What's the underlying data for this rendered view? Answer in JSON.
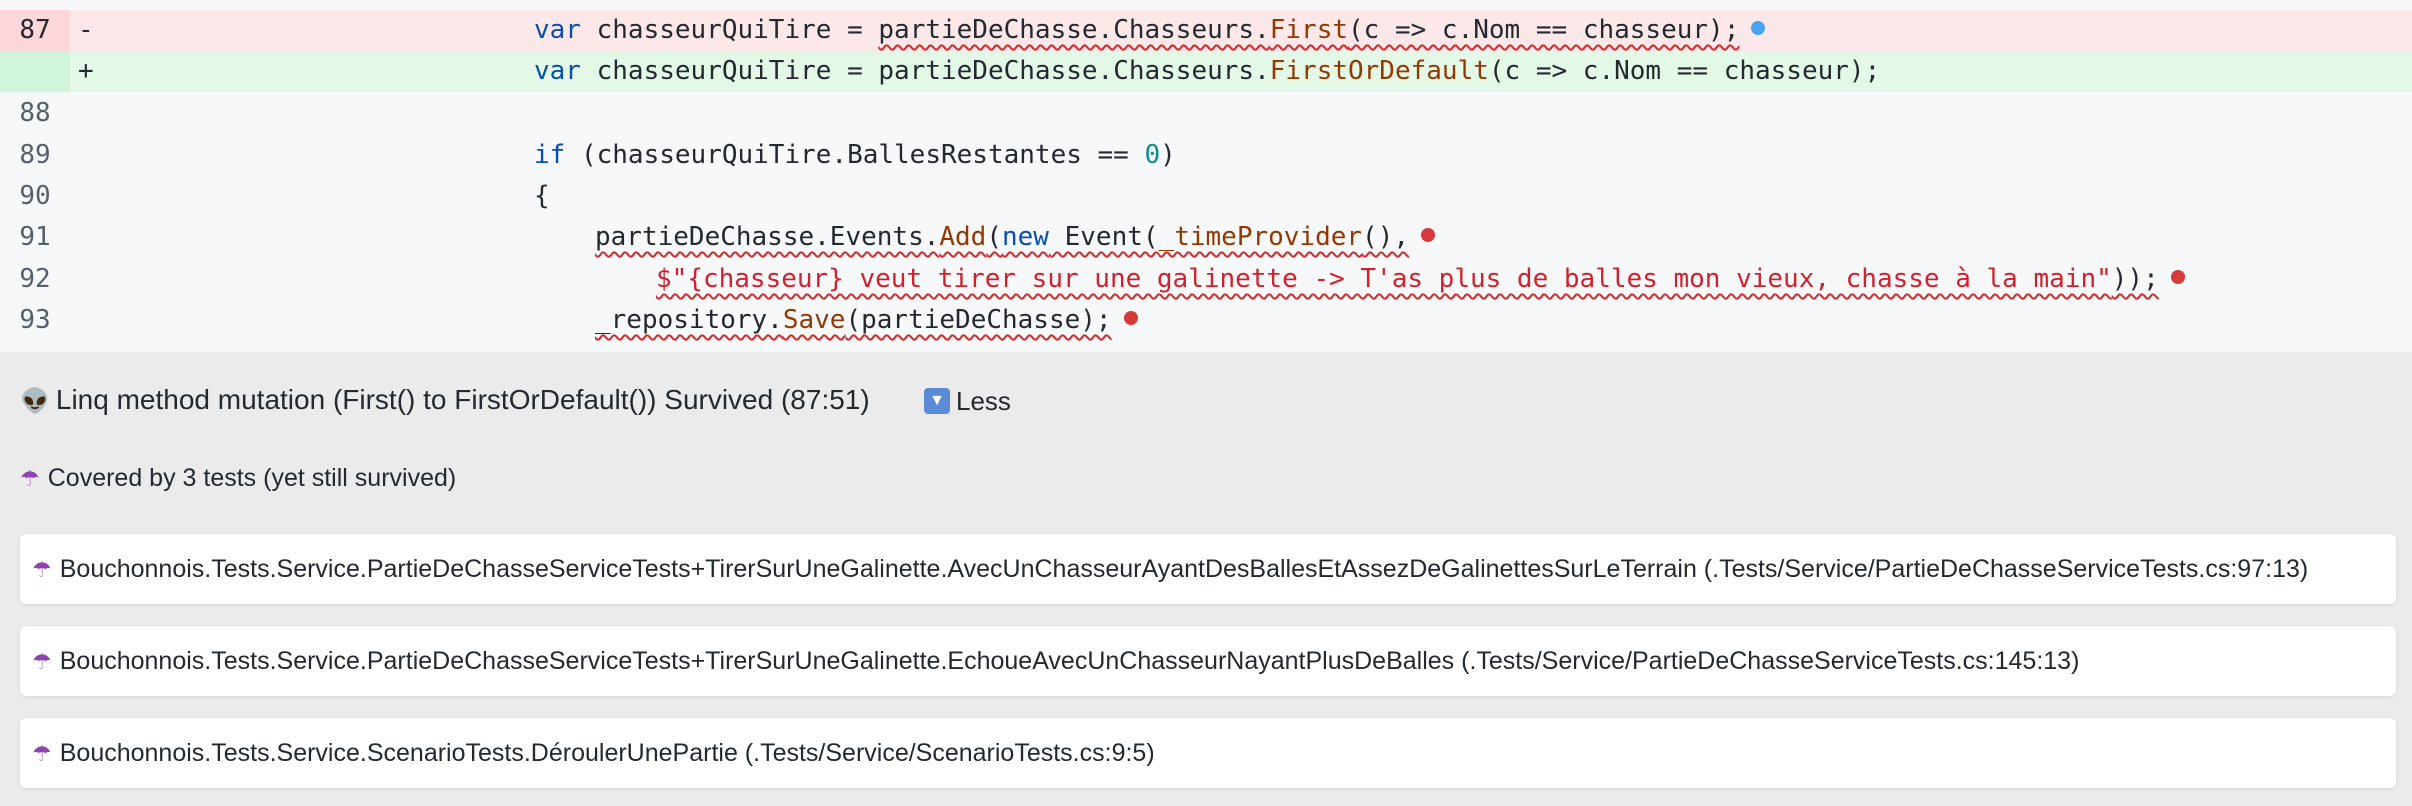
{
  "diff": {
    "rows": [
      {
        "line": "87",
        "sign": "-",
        "pre": "var chasseurQuiTire = ",
        "obj": "partieDeChasse.Chasseurs.",
        "method": "First",
        "post": "(c => c.Nom == chasseur);"
      },
      {
        "line": "",
        "sign": "+",
        "pre": "var chasseurQuiTire = ",
        "obj": "partieDeChasse.Chasseurs.",
        "method": "FirstOrDefault",
        "post": "(c => c.Nom == chasseur);"
      },
      {
        "line": "88"
      },
      {
        "line": "89",
        "kw": "if",
        "pre": " (chasseurQuiTire.BallesRestantes == ",
        "num": "0",
        "post": ")"
      },
      {
        "line": "90",
        "text": "{"
      },
      {
        "line": "91",
        "obj": "partieDeChasse.Events.",
        "method": "Add",
        "open": "(",
        "kw": "new",
        "mid": " Event(",
        "fn": "_timeProvider",
        "post": "(),"
      },
      {
        "line": "92",
        "str": "$\"{chasseur} veut tirer sur une galinette -> T'as plus de balles mon vieux, chasse à la main\"",
        "post": "));"
      },
      {
        "line": "93",
        "pre": "_repository.",
        "method": "Save",
        "post": "(partieDeChasse);"
      }
    ]
  },
  "mutant": {
    "emoji": "👽",
    "title": "Linq method mutation (First() to FirstOrDefault()) Survived (87:51)",
    "less_icon": "▼",
    "less_label": "Less"
  },
  "coverage": {
    "icon": "☂",
    "label": "Covered by 3 tests (yet still survived)"
  },
  "tests": [
    {
      "icon": "☂",
      "name": "Bouchonnois.Tests.Service.PartieDeChasseServiceTests+TirerSurUneGalinette.AvecUnChasseurAyantDesBallesEtAssezDeGalinettesSurLeTerrain (.Tests/Service/PartieDeChasseServiceTests.cs:97:13)"
    },
    {
      "icon": "☂",
      "name": "Bouchonnois.Tests.Service.PartieDeChasseServiceTests+TirerSurUneGalinette.EchoueAvecUnChasseurNayantPlusDeBalles (.Tests/Service/PartieDeChasseServiceTests.cs:145:13)"
    },
    {
      "icon": "☂",
      "name": "Bouchonnois.Tests.Service.ScenarioTests.DéroulerUnePartie (.Tests/Service/ScenarioTests.cs:9:5)"
    }
  ],
  "colors": {
    "deleted_bg": "#fde8e9",
    "added_bg": "#e4f8e8",
    "squiggle": "#d12b2b",
    "marker_blue": "#4aa3f0",
    "marker_red": "#d63b3b"
  }
}
